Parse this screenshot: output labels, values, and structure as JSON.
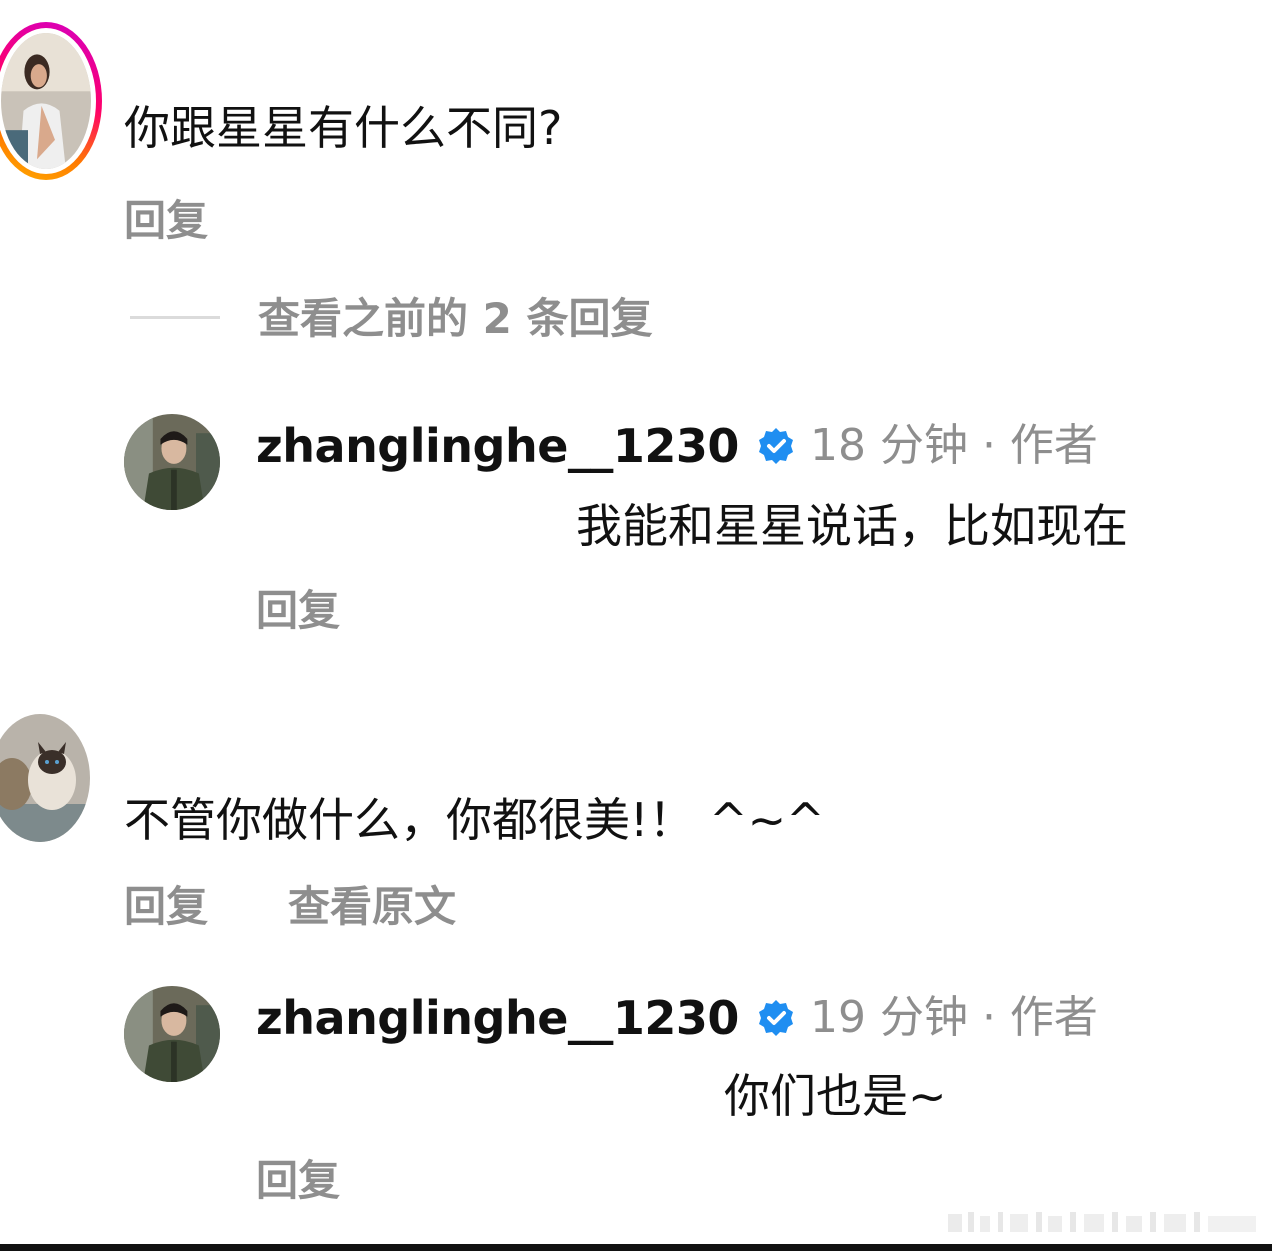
{
  "comments": [
    {
      "text": "你跟星星有什么不同?",
      "reply_label": "回复",
      "view_replies_label": "查看之前的 2 条回复",
      "reply": {
        "username": "zhanglinghe__1230",
        "meta": "18 分钟 · 作者",
        "text": "我能和星星说话，比如现在",
        "reply_label": "回复"
      }
    },
    {
      "text": "不管你做什么，你都很美!！ ^~^",
      "reply_label": "回复",
      "view_original_label": "查看原文",
      "reply": {
        "username": "zhanglinghe__1230",
        "meta": "19 分钟 · 作者",
        "text": "你们也是~",
        "reply_label": "回复"
      }
    }
  ],
  "colors": {
    "verified": "#1f8ef1",
    "secondary_text": "#8e8e8e",
    "story_ring_start": "#d300c5",
    "story_ring_end": "#ffb000"
  },
  "icons": {
    "verified": "verified-badge-icon"
  }
}
